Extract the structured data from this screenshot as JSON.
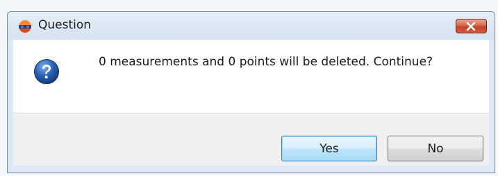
{
  "dialog": {
    "title": "Question",
    "message": "0 measurements and 0 points will be deleted. Continue?",
    "icon": "question-icon",
    "close_icon": "close-icon"
  },
  "buttons": {
    "yes_label": "Yes",
    "no_label": "No",
    "default": "yes"
  },
  "colors": {
    "content_bg": "#ffffff",
    "footer_bg": "#f0f0f0",
    "close_button": "#c5432a",
    "question_icon": "#2a62b0",
    "default_button_border": "#3c7fb1"
  }
}
